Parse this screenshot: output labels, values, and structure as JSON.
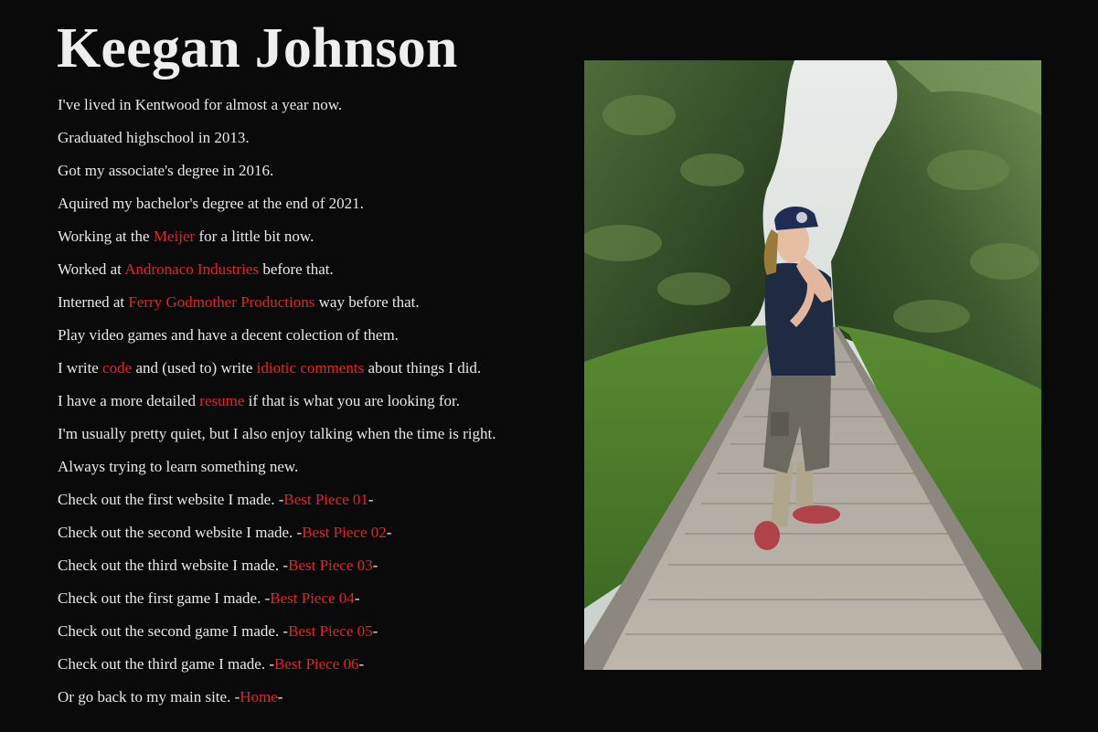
{
  "header": {
    "name": "Keegan Johnson"
  },
  "bio": {
    "lines": [
      {
        "text": "I've lived in Kentwood for almost a year now."
      },
      {
        "text": "Graduated highschool in 2013."
      },
      {
        "text": "Got my associate's degree in 2016."
      },
      {
        "text": "Aquired my bachelor's degree at the end of 2021."
      },
      {
        "before": "Working at the ",
        "link": "Meijer",
        "after": " for a little bit now."
      },
      {
        "before": "Worked at ",
        "link": "Andronaco Industries",
        "after": " before that."
      },
      {
        "before": "Interned at ",
        "link": "Ferry Godmother Productions",
        "after": " way before that."
      },
      {
        "text": "Play video games and have a decent colection of them."
      },
      {
        "before": "I write ",
        "link": "code",
        "middle": " and (used to) write ",
        "link2": "idiotic comments",
        "after": " about things I did."
      },
      {
        "before": "I have a more detailed ",
        "link": "resume",
        "after": " if that is what you are looking for."
      },
      {
        "text": "I'm usually pretty quiet, but I also enjoy talking when the time is right."
      },
      {
        "text": "Always trying to learn something new."
      },
      {
        "before": "Check out the first website I made. -",
        "link": "Best Piece 01",
        "after": "-"
      },
      {
        "before": "Check out the second website I made. -",
        "link": "Best Piece 02",
        "after": "-"
      },
      {
        "before": "Check out the third website I made. -",
        "link": "Best Piece 03",
        "after": "-"
      },
      {
        "before": "Check out the first game I made. -",
        "link": "Best Piece 04",
        "after": "-"
      },
      {
        "before": "Check out the second game I made. -",
        "link": "Best Piece 05",
        "after": "-"
      },
      {
        "before": "Check out the third game I made. -",
        "link": "Best Piece 06",
        "after": "-"
      },
      {
        "before": "Or go back to my main site. -",
        "link": "Home",
        "after": "-"
      }
    ]
  },
  "colors": {
    "background": "#0a0a0a",
    "text": "#e8e8e8",
    "link": "#e8202a"
  }
}
